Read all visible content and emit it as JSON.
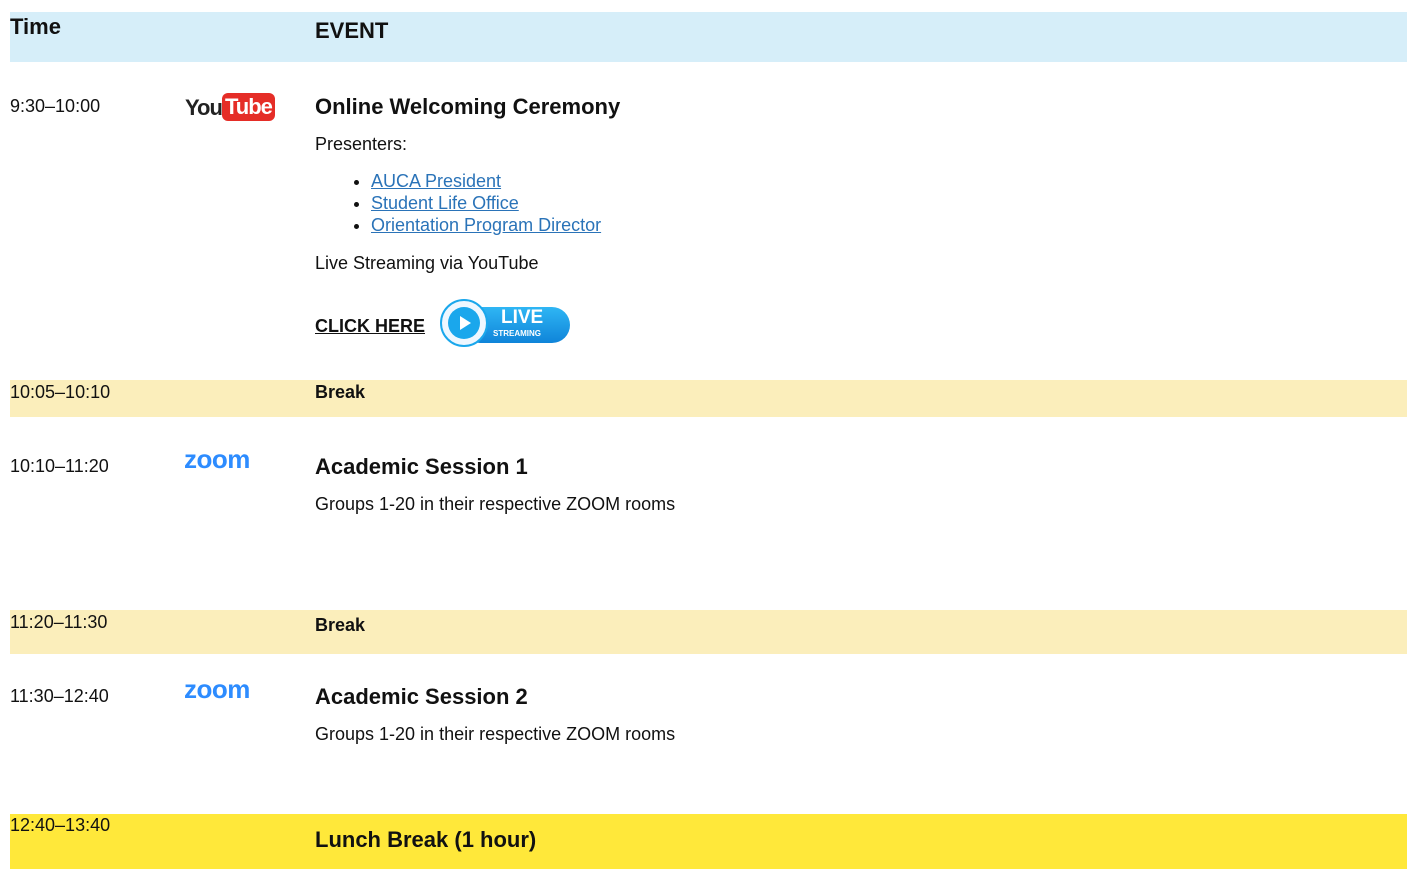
{
  "header": {
    "time_label": "Time",
    "event_label": "EVENT",
    "bg": "#d6eef9"
  },
  "rows": {
    "r1": {
      "time": "9:30–10:00",
      "icon": "youtube-icon",
      "title": "Online Welcoming Ceremony",
      "presenters_label": "Presenters:",
      "presenters": [
        "AUCA President",
        "Student Life Office",
        "Orientation Program Director"
      ],
      "streaming_text": "Live Streaming via YouTube",
      "cta_label": "CLICK HERE",
      "badge_live": "LIVE",
      "badge_streaming": "STREAMING"
    },
    "r2": {
      "time": "10:05–10:10",
      "title": "Break",
      "bg": "#fbeebb"
    },
    "r3": {
      "time": "10:10–11:20",
      "icon": "zoom-icon",
      "title": "Academic Session 1",
      "text": "Groups 1-20 in their respective ZOOM rooms"
    },
    "r4": {
      "time": "11:20–11:30",
      "title": "Break",
      "bg": "#fbeebb"
    },
    "r5": {
      "time": "11:30–12:40",
      "icon": "zoom-icon",
      "title": "Academic Session 2",
      "text": "Groups 1-20 in their respective ZOOM rooms"
    },
    "r6": {
      "time": "12:40–13:40",
      "title": "Lunch Break (1 hour)",
      "bg": "#ffe83a"
    }
  },
  "logos": {
    "youtube_you": "You",
    "youtube_tube": "Tube",
    "zoom": "zoom"
  },
  "colors": {
    "link": "#2a73b8",
    "youtube_red": "#e52d27",
    "zoom_blue": "#2d8cff",
    "live_blue": "#1aa7ec"
  }
}
